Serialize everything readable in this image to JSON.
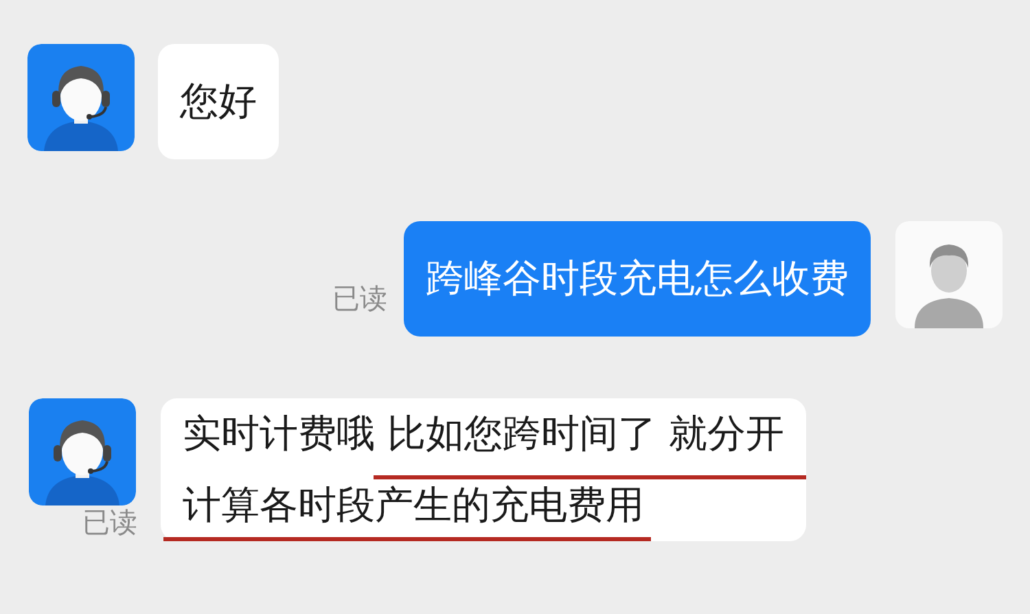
{
  "messages": [
    {
      "kind": "agent",
      "lines": [
        "您好"
      ],
      "underlined": false
    },
    {
      "kind": "user",
      "lines": [
        "跨峰谷时段充电怎么收费"
      ],
      "read_receipt": "已读",
      "underlined": false
    },
    {
      "kind": "agent",
      "lines": [
        "实时计费哦 比如您跨时间了 就分开",
        "计算各时段产生的充电费用"
      ],
      "read_receipt": "已读",
      "underlined": true
    }
  ]
}
